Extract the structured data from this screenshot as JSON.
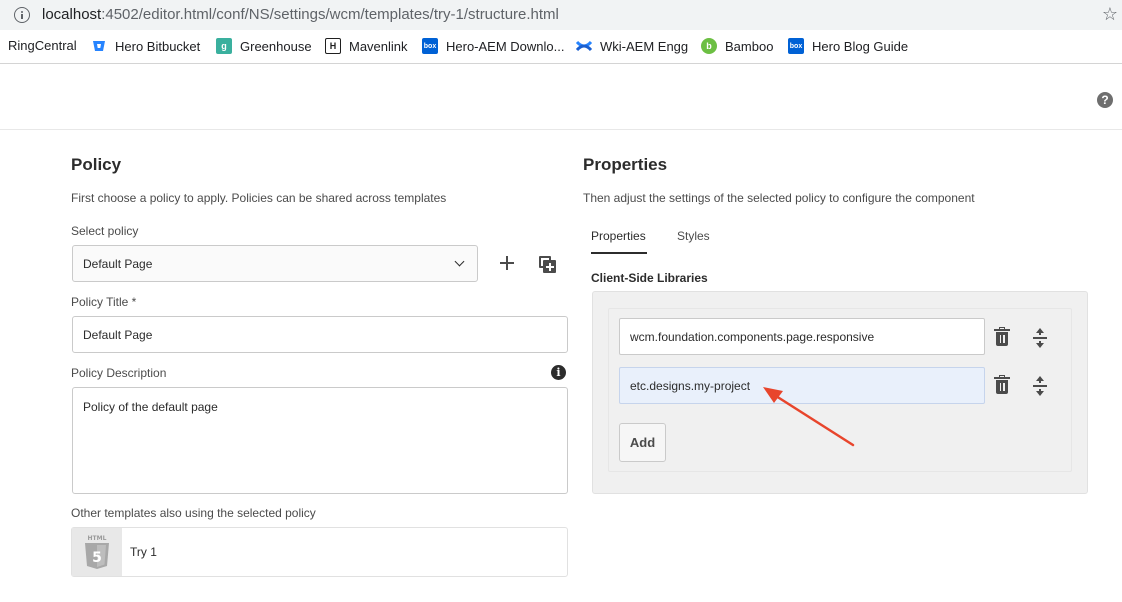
{
  "browser": {
    "url_host": "localhost",
    "url_rest": ":4502/editor.html/conf/NS/settings/wcm/templates/try-1/structure.html",
    "bookmarks": [
      {
        "label": "RingCentral",
        "icon": "none"
      },
      {
        "label": "Hero Bitbucket",
        "icon": "bitbucket-icon",
        "color": "#2684ff"
      },
      {
        "label": "Greenhouse",
        "icon": "greenhouse-icon",
        "color": "#3ab09e"
      },
      {
        "label": "Mavenlink",
        "icon": "mavenlink-icon",
        "color": "#1f1f1f"
      },
      {
        "label": "Hero-AEM Downlo...",
        "icon": "box-icon",
        "color": "#0061d5"
      },
      {
        "label": "Wki-AEM Engg",
        "icon": "confluence-icon",
        "color": "#2684ff"
      },
      {
        "label": "Bamboo",
        "icon": "bamboo-icon",
        "color": "#6cbf43"
      },
      {
        "label": "Hero Blog Guide",
        "icon": "box-icon",
        "color": "#0061d5"
      }
    ]
  },
  "policy": {
    "heading": "Policy",
    "description": "First choose a policy to apply. Policies can be shared across templates",
    "select_label": "Select policy",
    "select_value": "Default Page",
    "title_label": "Policy Title *",
    "title_value": "Default Page",
    "desc_label": "Policy Description",
    "desc_value": "Policy of the default page",
    "templates_label": "Other templates also using the selected policy",
    "templates": [
      {
        "name": "Try 1",
        "thumb_text": "HTML"
      }
    ]
  },
  "properties": {
    "heading": "Properties",
    "description": "Then adjust the settings of the selected policy to configure the component",
    "tabs": [
      {
        "label": "Properties",
        "active": true
      },
      {
        "label": "Styles",
        "active": false
      }
    ],
    "section_label": "Client-Side Libraries",
    "libraries": [
      "wcm.foundation.components.page.responsive",
      "etc.designs.my-project"
    ],
    "add_label": "Add"
  },
  "colors": {
    "annotation_arrow": "#e8452c",
    "focused_field": "#e9f0fb"
  }
}
